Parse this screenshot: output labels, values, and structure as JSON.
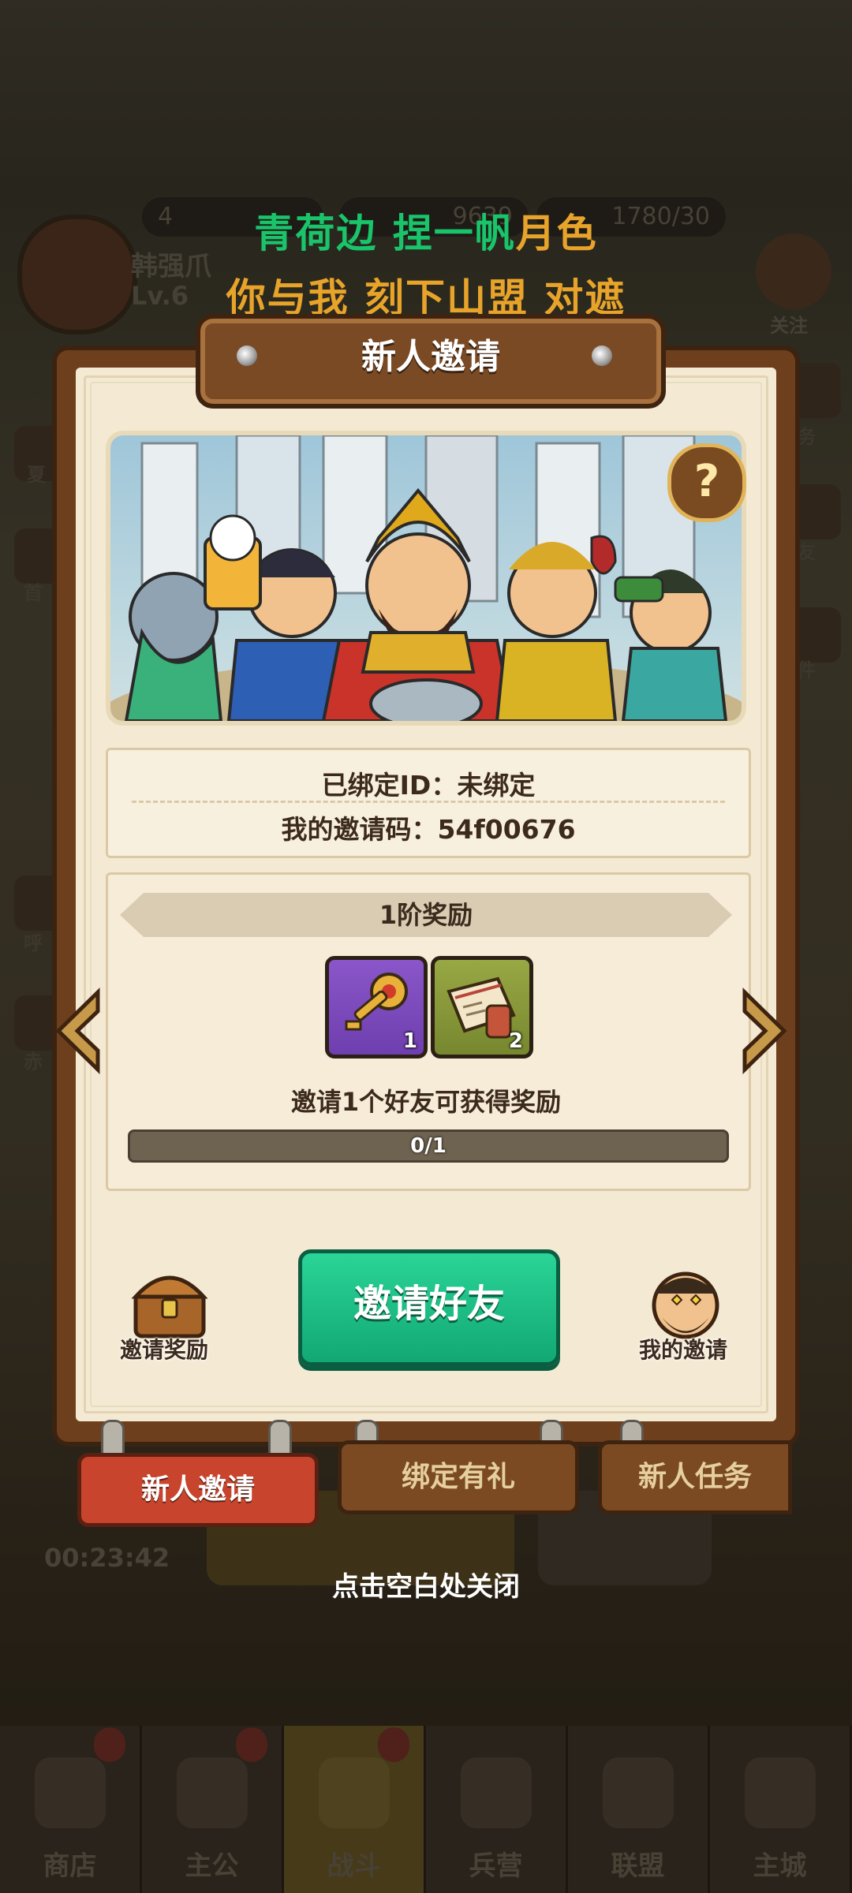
{
  "background": {
    "player": {
      "name": "韩强爪",
      "level": "Lv.6"
    },
    "resources": [
      "4",
      "9639",
      "1780/30"
    ],
    "follow_label": "关注",
    "timer": "00:23:42",
    "side_labels": [
      "夏",
      "首",
      "呼",
      "赤",
      "务",
      "友",
      "件"
    ]
  },
  "lyrics": {
    "line1_green": "青荷边 捏一帆",
    "line1_orange": "月色",
    "line2": "你与我 刻下山盟 对遮"
  },
  "dialog": {
    "title": "新人邀请",
    "bound_id": "已绑定ID：未绑定",
    "invite_code": "我的邀请码：54f00676",
    "help_symbol": "?",
    "tier_label": "1阶奖励",
    "rewards": [
      {
        "icon": "key-icon",
        "count": "1",
        "color": "#7b48bc"
      },
      {
        "icon": "scroll-icon",
        "count": "2",
        "color": "#8a9a3a"
      }
    ],
    "invite_hint": "邀请1个好友可获得奖励",
    "progress": {
      "text": "0/1",
      "fraction": 0
    },
    "invite_button": "邀请好友",
    "left_corner_label": "邀请奖励",
    "right_corner_label": "我的邀请"
  },
  "tabs": [
    "新人邀请",
    "绑定有礼",
    "新人任务"
  ],
  "close_hint": "点击空白处关闭",
  "nav": [
    "商店",
    "主公",
    "战斗",
    "兵营",
    "联盟",
    "主城"
  ]
}
